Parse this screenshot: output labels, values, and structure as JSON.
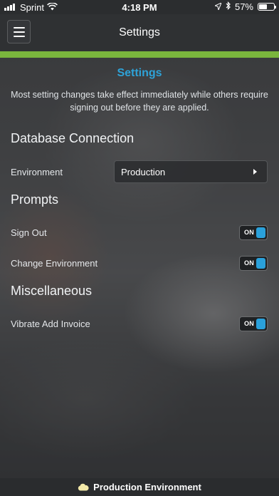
{
  "status_bar": {
    "carrier": "Sprint",
    "time": "4:18 PM",
    "battery_percent": "57%",
    "battery_level": 0.57,
    "icons": [
      "signal-bars-icon",
      "wifi-icon",
      "location-arrow-icon",
      "bluetooth-icon",
      "battery-icon"
    ]
  },
  "navbar": {
    "title": "Settings",
    "menu_icon": "hamburger-menu-icon"
  },
  "colors": {
    "accent_green": "#7ab53d",
    "heading_blue": "#2ea3d8",
    "toggle_blue": "#2aa1db"
  },
  "settings": {
    "heading": "Settings",
    "intro": "Most setting changes take effect immediately while others require signing out before they are applied."
  },
  "database_connection": {
    "title": "Database Connection",
    "environment_label": "Environment",
    "environment_value": "Production"
  },
  "prompts": {
    "title": "Prompts",
    "sign_out_label": "Sign Out",
    "sign_out_toggle": "ON",
    "change_environment_label": "Change Environment",
    "change_environment_toggle": "ON"
  },
  "miscellaneous": {
    "title": "Miscellaneous",
    "vibrate_label": "Vibrate Add Invoice",
    "vibrate_toggle": "ON"
  },
  "footer": {
    "label": "Production Environment",
    "icon": "cloud-icon"
  }
}
